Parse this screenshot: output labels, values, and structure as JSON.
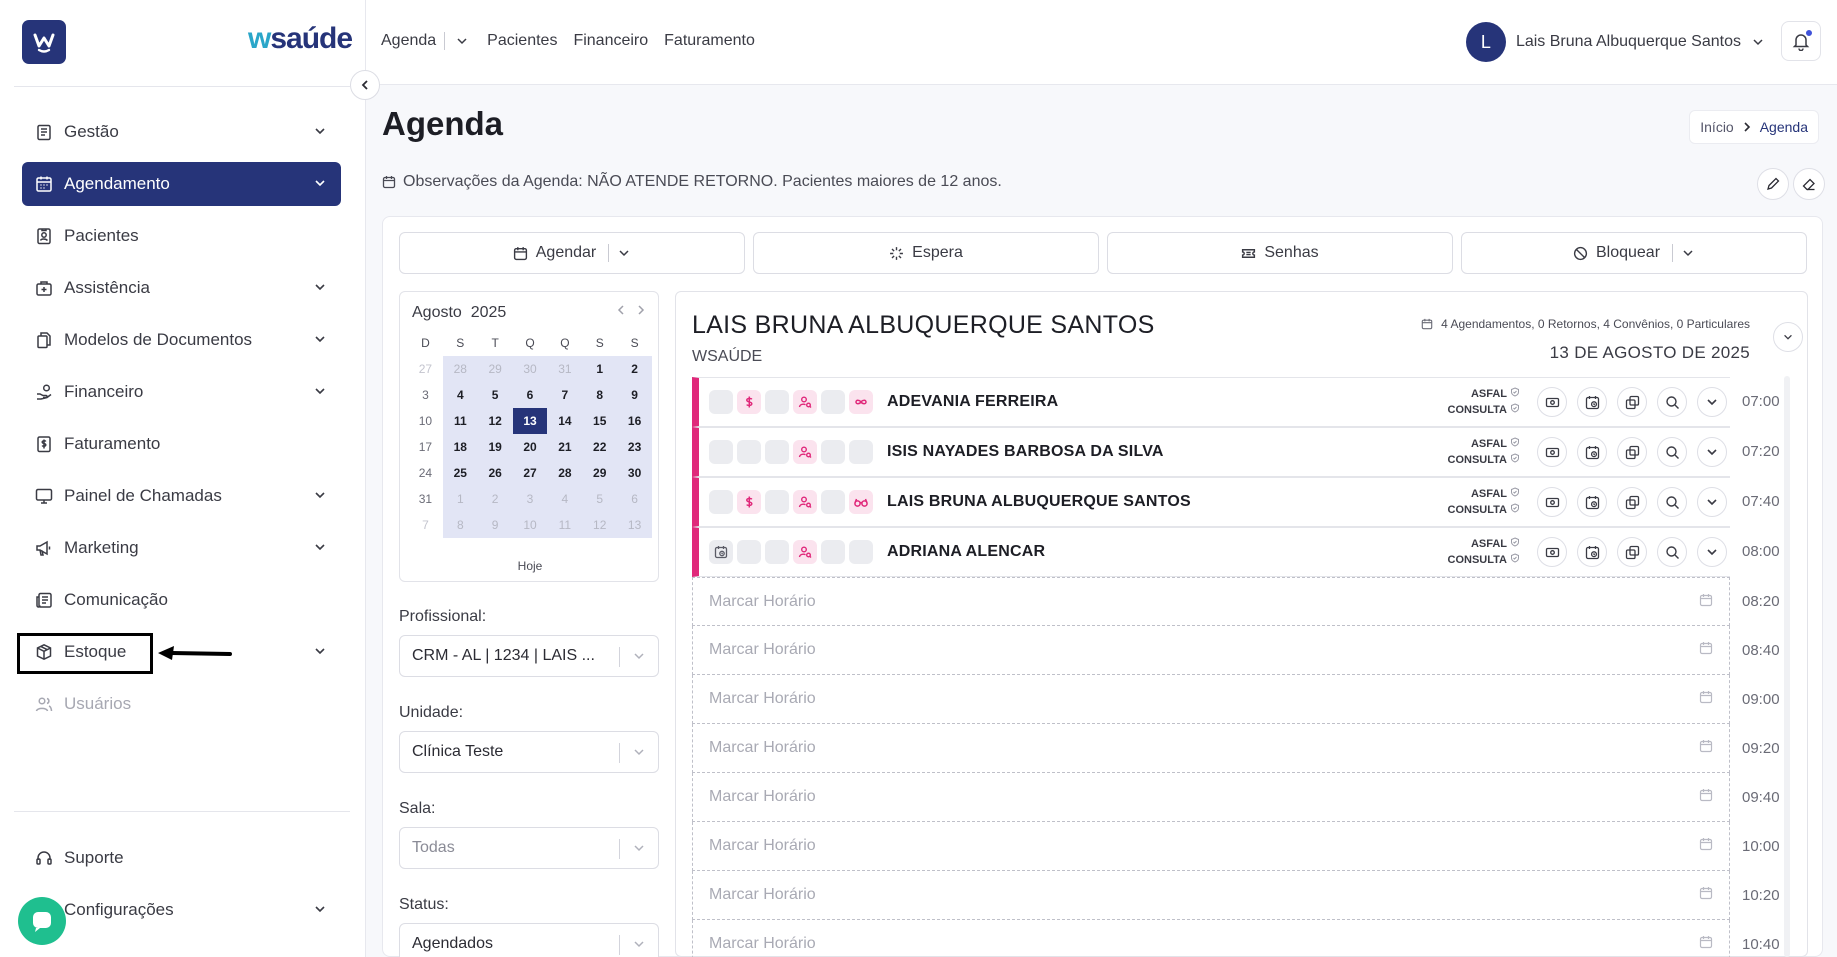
{
  "brand": {
    "logo_letter": "W",
    "name": "saúde",
    "name_prefix": "w"
  },
  "sidebar": {
    "items": [
      {
        "label": "Gestão",
        "icon": "clipboard-icon",
        "chevron": true
      },
      {
        "label": "Agendamento",
        "icon": "calendar-icon",
        "chevron": true,
        "active": true
      },
      {
        "label": "Pacientes",
        "icon": "patient-id-icon",
        "chevron": false
      },
      {
        "label": "Assistência",
        "icon": "medical-bag-icon",
        "chevron": true
      },
      {
        "label": "Modelos de Documentos",
        "icon": "documents-icon",
        "chevron": true
      },
      {
        "label": "Financeiro",
        "icon": "hand-coins-icon",
        "chevron": true
      },
      {
        "label": "Faturamento",
        "icon": "dollar-receipt-icon",
        "chevron": false
      },
      {
        "label": "Painel de Chamadas",
        "icon": "monitor-icon",
        "chevron": true
      },
      {
        "label": "Marketing",
        "icon": "megaphone-icon",
        "chevron": true
      },
      {
        "label": "Comunicação",
        "icon": "newspaper-icon",
        "chevron": false
      },
      {
        "label": "Estoque",
        "icon": "box-icon",
        "chevron": true
      },
      {
        "label": "Usuários",
        "icon": "users-icon",
        "chevron": false,
        "disabled": true
      }
    ],
    "bottom": [
      {
        "label": "Suporte",
        "icon": "headset-icon"
      },
      {
        "label": "Configurações",
        "icon": "gear-icon"
      }
    ]
  },
  "topnav": {
    "agenda": "Agenda",
    "pacientes": "Pacientes",
    "financeiro": "Financeiro",
    "faturamento": "Faturamento"
  },
  "user": {
    "initial": "L",
    "name": "Lais Bruna Albuquerque Santos"
  },
  "page": {
    "title": "Agenda",
    "breadcrumb": {
      "home": "Início",
      "current": "Agenda"
    },
    "observacoes": "Observações da Agenda: NÃO ATENDE RETORNO. Pacientes maiores de 12 anos."
  },
  "actions": {
    "agendar": "Agendar",
    "espera": "Espera",
    "senhas": "Senhas",
    "bloquear": "Bloquear"
  },
  "calendar": {
    "month": "Agosto",
    "year": "2025",
    "weekdays": [
      "D",
      "S",
      "T",
      "Q",
      "Q",
      "S",
      "S"
    ],
    "weeks": [
      [
        "27",
        "28",
        "29",
        "30",
        "31",
        "1",
        "2"
      ],
      [
        "3",
        "4",
        "5",
        "6",
        "7",
        "8",
        "9"
      ],
      [
        "10",
        "11",
        "12",
        "13",
        "14",
        "15",
        "16"
      ],
      [
        "17",
        "18",
        "19",
        "20",
        "21",
        "22",
        "23"
      ],
      [
        "24",
        "25",
        "26",
        "27",
        "28",
        "29",
        "30"
      ],
      [
        "31",
        "1",
        "2",
        "3",
        "4",
        "5",
        "6"
      ],
      [
        "7",
        "8",
        "9",
        "10",
        "11",
        "12",
        "13"
      ]
    ],
    "selected": "13",
    "today_label": "Hoje"
  },
  "filters": {
    "profissional": {
      "label": "Profissional:",
      "value": "CRM - AL | 1234 | LAIS ..."
    },
    "unidade": {
      "label": "Unidade:",
      "value": "Clínica Teste"
    },
    "sala": {
      "label": "Sala:",
      "value": "Todas"
    },
    "status": {
      "label": "Status:",
      "value": "Agendados"
    }
  },
  "schedule": {
    "doctor": "LAIS BRUNA ALBUQUERQUE SANTOS",
    "org": "WSAÚDE",
    "stats": "4 Agendamentos, 0 Retornos, 4 Convênios, 0 Particulares",
    "date": "13 DE AGOSTO DE 2025",
    "appointments": [
      {
        "name": "ADEVANIA FERREIRA",
        "tag1": "ASFAL",
        "tag2": "CONSULTA",
        "time": "07:00"
      },
      {
        "name": "ISIS NAYADES BARBOSA DA SILVA",
        "tag1": "ASFAL",
        "tag2": "CONSULTA",
        "time": "07:20"
      },
      {
        "name": "LAIS BRUNA ALBUQUERQUE SANTOS",
        "tag1": "ASFAL",
        "tag2": "CONSULTA",
        "time": "07:40"
      },
      {
        "name": "ADRIANA ALENCAR",
        "tag1": "ASFAL",
        "tag2": "CONSULTA",
        "time": "08:00"
      }
    ],
    "empty_label": "Marcar Horário",
    "empty_times": [
      "08:20",
      "08:40",
      "09:00",
      "09:20",
      "09:40",
      "10:00",
      "10:20",
      "10:40"
    ]
  },
  "colors": {
    "primary": "#263479",
    "accent_pink": "#e0287a",
    "chat": "#1fbf8f"
  }
}
